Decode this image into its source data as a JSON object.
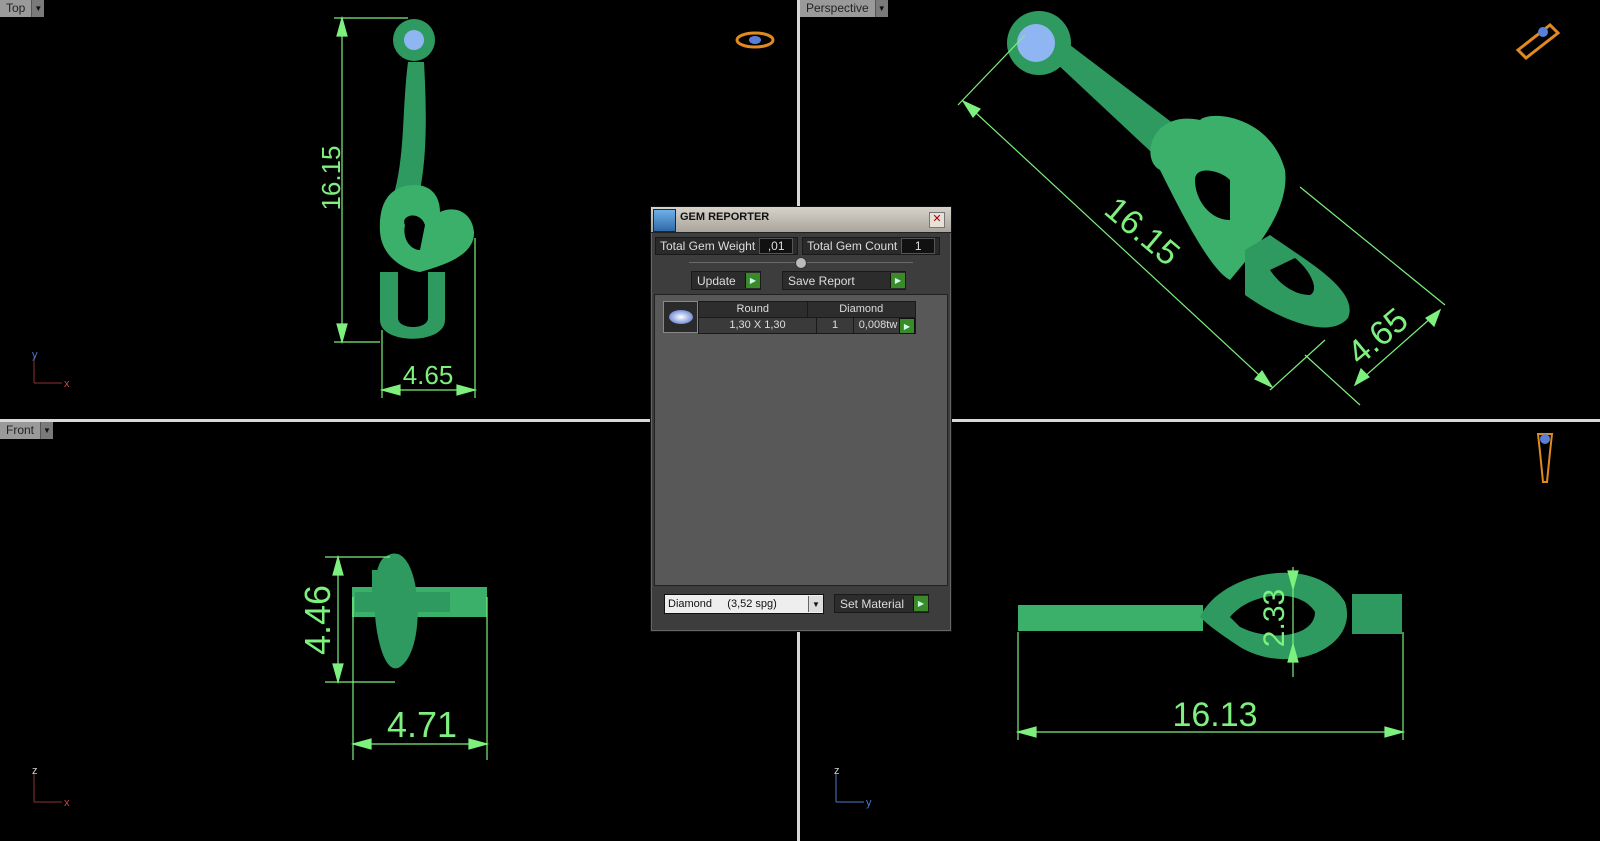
{
  "viewports": {
    "top": {
      "label": "Top",
      "dim_vertical": "16.15",
      "dim_horizontal": "4.65",
      "axis_v": "y",
      "axis_h": "x"
    },
    "perspective": {
      "label": "Perspective",
      "dim_long": "16.15",
      "dim_short": "4.65"
    },
    "front": {
      "label": "Front",
      "dim_vertical": "4.46",
      "dim_horizontal": "4.71",
      "axis_v": "z",
      "axis_h": "x"
    },
    "right": {
      "dim_vertical": "2.33",
      "dim_horizontal": "16.13",
      "axis_v": "z",
      "axis_h": "y"
    }
  },
  "gem_reporter": {
    "title": "GEM REPORTER",
    "total_weight_label": "Total Gem Weight",
    "total_weight_value": ",01",
    "total_count_label": "Total Gem Count",
    "total_count_value": "1",
    "update_label": "Update",
    "save_report_label": "Save Report",
    "gem": {
      "cut": "Round",
      "material": "Diamond",
      "size": "1,30 X 1,30",
      "count": "1",
      "weight": "0,008tw"
    },
    "material_selected": "Diamond     (3,52 spg)",
    "set_material_label": "Set Material"
  },
  "colors": {
    "model": "#2f9a5f",
    "dimension": "#7df07d",
    "background": "#000000"
  }
}
